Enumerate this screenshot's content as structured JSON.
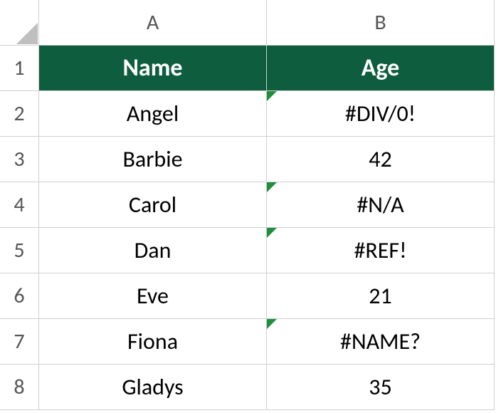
{
  "columns": [
    "A",
    "B"
  ],
  "row_numbers": [
    "1",
    "2",
    "3",
    "4",
    "5",
    "6",
    "7",
    "8"
  ],
  "headers": {
    "name": "Name",
    "age": "Age"
  },
  "rows": [
    {
      "name": "Angel",
      "age": "#DIV/0!",
      "error": true
    },
    {
      "name": "Barbie",
      "age": "42",
      "error": false
    },
    {
      "name": "Carol",
      "age": "#N/A",
      "error": true
    },
    {
      "name": "Dan",
      "age": "#REF!",
      "error": true
    },
    {
      "name": "Eve",
      "age": "21",
      "error": false
    },
    {
      "name": "Fiona",
      "age": "#NAME?",
      "error": true
    },
    {
      "name": "Gladys",
      "age": "35",
      "error": false
    }
  ],
  "chart_data": {
    "type": "table",
    "title": "",
    "columns": [
      "Name",
      "Age"
    ],
    "data": [
      [
        "Angel",
        "#DIV/0!"
      ],
      [
        "Barbie",
        42
      ],
      [
        "Carol",
        "#N/A"
      ],
      [
        "Dan",
        "#REF!"
      ],
      [
        "Eve",
        21
      ],
      [
        "Fiona",
        "#NAME?"
      ],
      [
        "Gladys",
        35
      ]
    ]
  }
}
